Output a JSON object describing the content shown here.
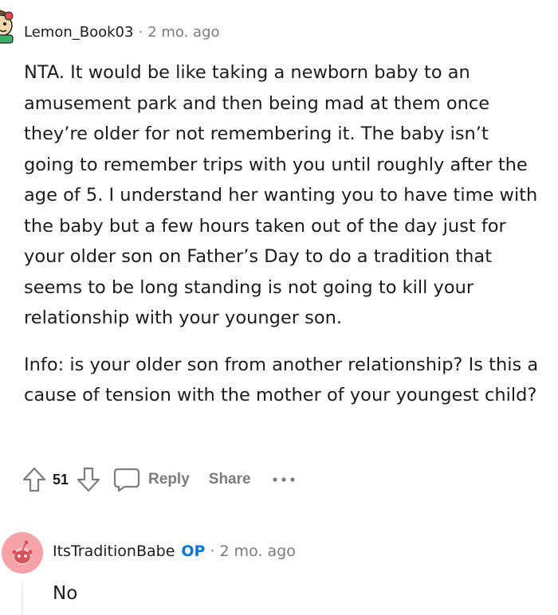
{
  "comments": [
    {
      "author": "Lemon_Book03",
      "separator": "·",
      "time": "2 mo. ago",
      "avatar_icon": "snoo-avatar-icon",
      "paragraphs": [
        "NTA. It would be like taking a newborn baby to an amusement park and then being mad at them once they’re older for not remembering it. The baby isn’t going to remember trips with you until roughly after the age of 5. I understand her wanting you to have time with the baby but a few hours taken out of the day just for your older son on Father’s Day to do a tradition that seems to be long standing is not going to kill your relationship with your younger son.",
        "Info: is your older son from another relationship? Is this a cause of tension with the mother of your youngest child?"
      ],
      "actions": {
        "upvote_icon": "upvote-arrow-icon",
        "score": "51",
        "downvote_icon": "downvote-arrow-icon",
        "reply_icon": "speech-bubble-icon",
        "reply_label": "Reply",
        "share_label": "Share",
        "more_icon": "more-dots-icon"
      }
    },
    {
      "author": "ItsTraditionBabe",
      "op_badge": "OP",
      "separator": "·",
      "time": "2 mo. ago",
      "avatar_icon": "snoo-avatar-icon",
      "avatar_color": "#f5a3a8",
      "text": "No"
    }
  ],
  "colors": {
    "text": "#1c1c1c",
    "muted": "#7c7c7c",
    "op_blue": "#0079d3"
  }
}
